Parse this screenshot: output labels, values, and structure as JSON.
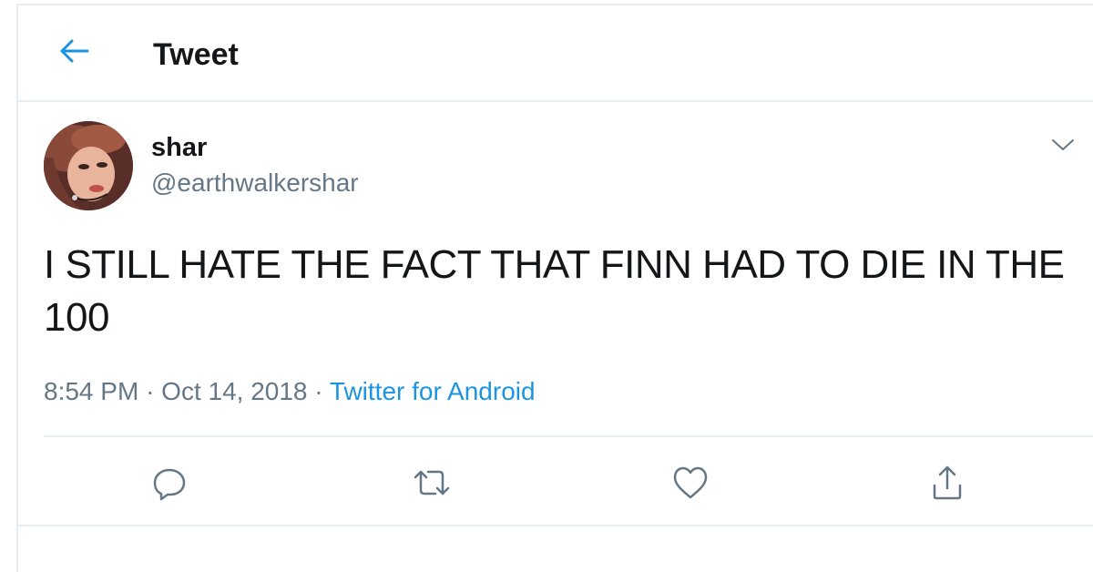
{
  "header": {
    "back_icon": "arrow-left-icon",
    "title": "Tweet"
  },
  "tweet": {
    "author": {
      "name": "shar",
      "handle": "@earthwalkershar"
    },
    "text": "I STILL HATE THE FACT THAT FINN HAD TO DIE IN THE 100",
    "time": "8:54 PM",
    "separator": "·",
    "date": "Oct 14, 2018",
    "source": "Twitter for Android"
  },
  "actions": {
    "icons": [
      "reply-icon",
      "retweet-icon",
      "like-icon",
      "share-icon"
    ]
  },
  "colors": {
    "accent": "#1b95e0",
    "text": "#14171a",
    "secondary": "#657786",
    "border": "#e6ecf0"
  }
}
